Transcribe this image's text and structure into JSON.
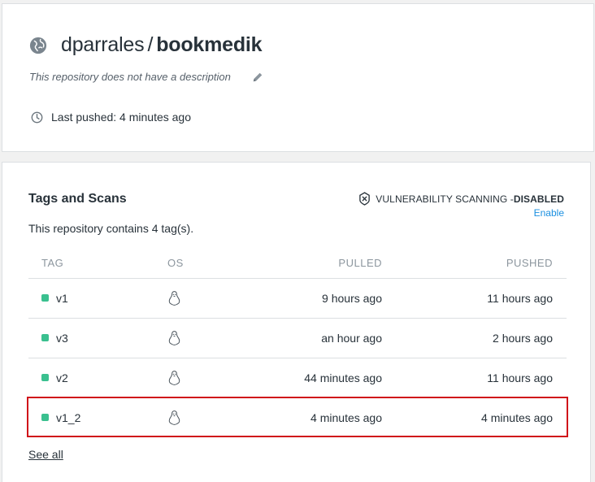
{
  "repo": {
    "owner": "dparrales",
    "separator": "/",
    "name": "bookmedik",
    "description": "This repository does not have a description",
    "last_pushed": "Last pushed: 4 minutes ago"
  },
  "tags": {
    "title": "Tags and Scans",
    "count_text": "This repository contains 4 tag(s).",
    "vulnerability": {
      "label": "VULNERABILITY SCANNING - ",
      "status": "DISABLED",
      "enable_label": "Enable"
    },
    "columns": {
      "tag": "TAG",
      "os": "OS",
      "pulled": "PULLED",
      "pushed": "PUSHED"
    },
    "rows": [
      {
        "tag": "v1",
        "os": "linux-icon",
        "pulled": "9 hours ago",
        "pushed": "11 hours ago"
      },
      {
        "tag": "v3",
        "os": "linux-icon",
        "pulled": "an hour ago",
        "pushed": "2 hours ago"
      },
      {
        "tag": "v2",
        "os": "linux-icon",
        "pulled": "44 minutes ago",
        "pushed": "11 hours ago"
      },
      {
        "tag": "v1_2",
        "os": "linux-icon",
        "pulled": "4 minutes ago",
        "pushed": "4 minutes ago"
      }
    ],
    "see_all": "See all"
  },
  "colors": {
    "tag_dot": "#3ac08f",
    "link": "#1a8fe0",
    "highlight": "#d0131a"
  }
}
